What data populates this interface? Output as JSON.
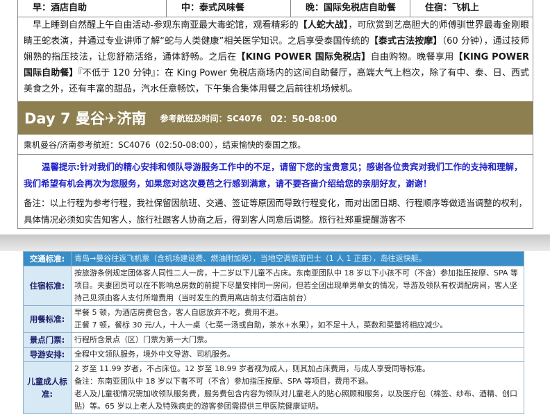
{
  "meals": [
    {
      "label": "早：酒店自助",
      "width": 214
    },
    {
      "label": "中：泰式风味餐",
      "width": 179
    },
    {
      "label": "晚：国际免税店自助餐",
      "width": 172
    },
    {
      "label": "住宿：飞机上",
      "width": 176
    }
  ],
  "day6_description": {
    "p1": "早上睡到自然醒上午自由活动-参观东南亚最大毒蛇馆，观看精彩的",
    "h1": "【人蛇大战】",
    "p2": "，可欣赏到艺高胆大的师傅驯世界最毒金刚眼睛王蛇表演，并通过专业讲师了解",
    "p3": "“蛇与人类健康”",
    "p4": "相关医学知识。之后享受泰国传统的",
    "h2": "【泰式古法按摩】",
    "p5": "（60 分钟），通过技师娴熟的指压技法，让您舒筋活络，通体舒畅。之后在",
    "h3": "【KING POWER 国际免税店】",
    "p6": "自由购物。晚餐享用",
    "h4": "【KING POWER 国际自助餐】",
    "p7": "『不低于 120 分钟』：在 King Power 免税店商场内的这间自助餐厅，高端大气上档次，除了有中、泰、日、西式美食之外，还有丰富的甜品，汽水任意畅饮，下午集合集体用餐之后前往机场候机。"
  },
  "day7": {
    "title": "Day 7 曼谷✈济南",
    "flight_ref_label": "参考航班及时间：SC4076",
    "flight_time": "02：50-08:00",
    "description": "乘机曼谷/济南参考航班：SC4076（02:50-08:00），结束愉快的泰国之旅。"
  },
  "tips": "温馨提示:针对我们的精心安排和领队导游服务工作中的不足，请留下您的宝贵意见；感谢各位贵宾对我们工作的支持和理解，我们希望有机会再次为您服务，如果您对这次曼芭之行感到满意，请不要吝啬介绍给您的亲朋好友，谢谢！",
  "note": "备注：以上行程为参考行程，我社保留因航班、交通、签证等原因而导致行程变化，而对出团日期、行程顺序等做适当调整的权利，具体情况必须如实告知客人，旅行社跟客人协商之后，得到客人同意后调整。旅行社郑重提醒游客不",
  "terms": [
    {
      "label": "交通标准:",
      "content": [
        "青岛→曼谷往返飞机票（含机场建设费、燃油附加税），当地空调旅游巴士（1 人 1 正座），岛往返快艇。"
      ]
    },
    {
      "label": "住宿标准:",
      "content": [
        "按旅游条例规定团体客人同性二人一房，十二岁以下儿童不占床。东南亚团队中 18 岁以下小孩不可（不含）参加指压按摩、SPA 等项目。夫妻团员可以在不影响总房数的前提下尽量安排同一房间，但若全团出现单男单女的情况，导游及领队有权调配房间，客人坚持己见须由客人支付所增费用（当时发生的费用离店前支付酒店前台）"
      ]
    },
    {
      "label": "用餐标准:",
      "content": [
        "早餐 5 顿，为酒店房费包含，客人自愿放弃不吃，费用不退。",
        "正餐 7 顿，餐标 30 元/人，十人一桌（七菜一汤或自助，茶水+水果），如不足十人，菜数和菜量将相应减少。"
      ]
    },
    {
      "label": "景点门票:",
      "content": [
        "行程所含景点（区）门票为第一大门票。"
      ]
    },
    {
      "label": "导游安排:",
      "content": [
        "全程中文领队服务，境外中文导游、司机服务。"
      ]
    },
    {
      "label": "儿童成人标准:",
      "content": [
        "2 岁至 11.99 岁者，不占床位。12 岁至 18.99 岁者视为成人，则其加占床费用，与成人享受同等标准。",
        "备注：东南亚团队中 18 岁以下者不可（不含）参加指压按摩、SPA 等项目，费用不退。",
        "老人及儿童视情况需加收领队服务费，服务费包含内容为领队对儿童老人的贴心照顾和服务，以及医疗包（棉签、纱布、酒精、创口贴）等。65 岁以上老人及特殊病史的游客参团需提供三甲医院健康证明。"
      ]
    }
  ]
}
